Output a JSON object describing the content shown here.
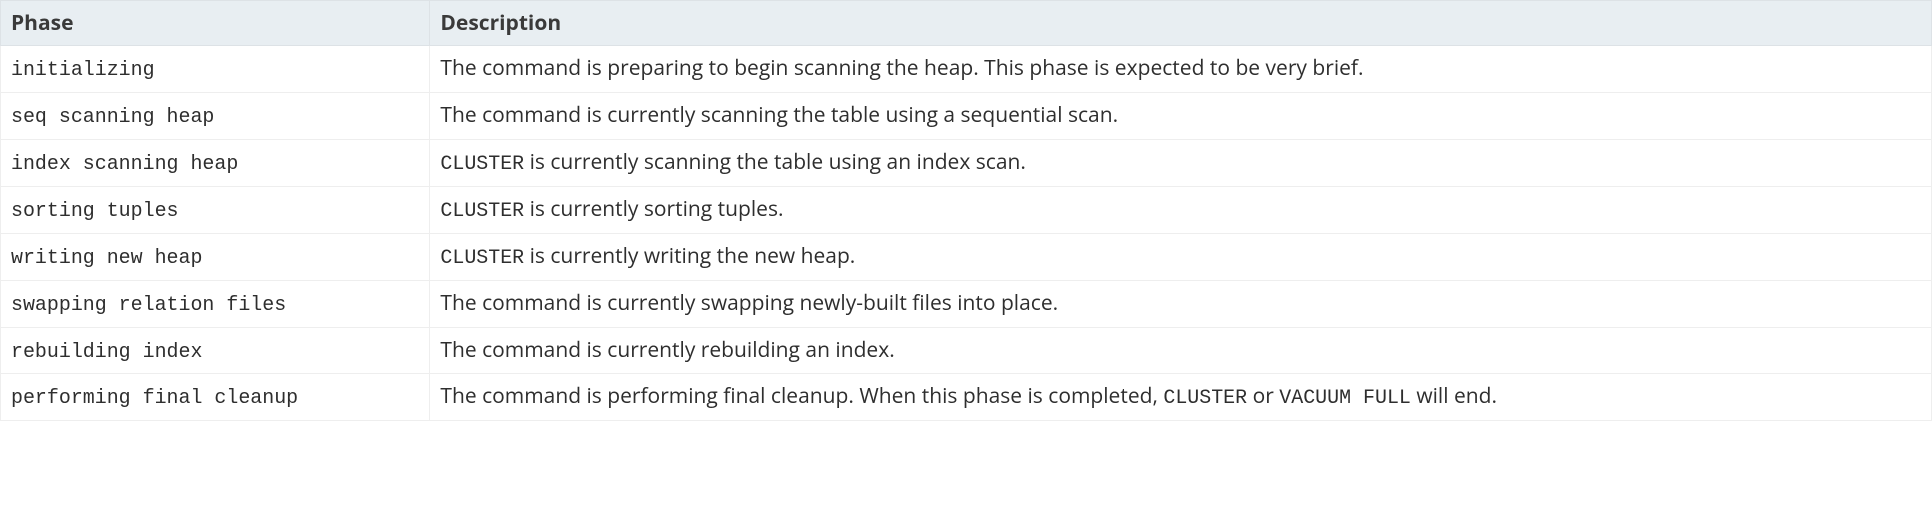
{
  "table": {
    "headers": {
      "phase": "Phase",
      "description": "Description"
    },
    "rows": [
      {
        "phase": "initializing",
        "desc": [
          {
            "text": "The command is preparing to begin scanning the heap. This phase is expected to be very brief."
          }
        ]
      },
      {
        "phase": "seq scanning heap",
        "desc": [
          {
            "text": "The command is currently scanning the table using a sequential scan."
          }
        ]
      },
      {
        "phase": "index scanning heap",
        "desc": [
          {
            "code": "CLUSTER"
          },
          {
            "text": " is currently scanning the table using an index scan."
          }
        ]
      },
      {
        "phase": "sorting tuples",
        "desc": [
          {
            "code": "CLUSTER"
          },
          {
            "text": " is currently sorting tuples."
          }
        ]
      },
      {
        "phase": "writing new heap",
        "desc": [
          {
            "code": "CLUSTER"
          },
          {
            "text": " is currently writing the new heap."
          }
        ]
      },
      {
        "phase": "swapping relation files",
        "desc": [
          {
            "text": "The command is currently swapping newly-built files into place."
          }
        ]
      },
      {
        "phase": "rebuilding index",
        "desc": [
          {
            "text": "The command is currently rebuilding an index."
          }
        ]
      },
      {
        "phase": "performing final cleanup",
        "desc": [
          {
            "text": "The command is performing final cleanup. When this phase is completed, "
          },
          {
            "code": "CLUSTER"
          },
          {
            "text": " or "
          },
          {
            "code": "VACUUM FULL"
          },
          {
            "text": " will end."
          }
        ]
      }
    ]
  }
}
